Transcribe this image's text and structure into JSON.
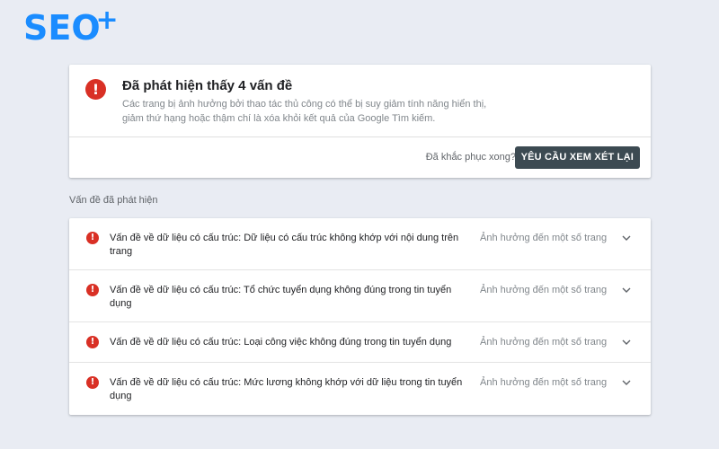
{
  "brand": {
    "logo_text": "SEO",
    "logo_plus": "+"
  },
  "summary": {
    "title": "Đã phát hiện thấy 4 vấn đề",
    "description": "Các trang bị ảnh hưởng bởi thao tác thủ công có thể bị suy giảm tính năng hiển thị, giảm thứ hạng hoặc thậm chí là xóa khỏi kết quả của Google Tìm kiếm.",
    "fixed_question": "Đã khắc phục xong?",
    "review_button": "YÊU CẦU XEM XÉT LẠI",
    "icon": "error-icon"
  },
  "issues_label": "Vấn đề đã phát hiện",
  "issues": [
    {
      "text": "Vấn đề về dữ liệu có cấu trúc: Dữ liệu có cấu trúc không khớp với nội dung trên trang",
      "impact": "Ảnh hưởng đến một số trang"
    },
    {
      "text": "Vấn đề về dữ liệu có cấu trúc: Tổ chức tuyển dụng không đúng trong tin tuyển dụng",
      "impact": "Ảnh hưởng đến một số trang"
    },
    {
      "text": "Vấn đề về dữ liệu có cấu trúc: Loại công việc không đúng trong tin tuyển dụng",
      "impact": "Ảnh hưởng đến một số trang"
    },
    {
      "text": "Vấn đề về dữ liệu có cấu trúc: Mức lương không khớp với dữ liệu trong tin tuyển dụng",
      "impact": "Ảnh hưởng đến một số trang"
    }
  ],
  "colors": {
    "error": "#d93025",
    "button": "#3c4a52",
    "logo": "#1a8cff",
    "background": "#e9ecf3"
  }
}
